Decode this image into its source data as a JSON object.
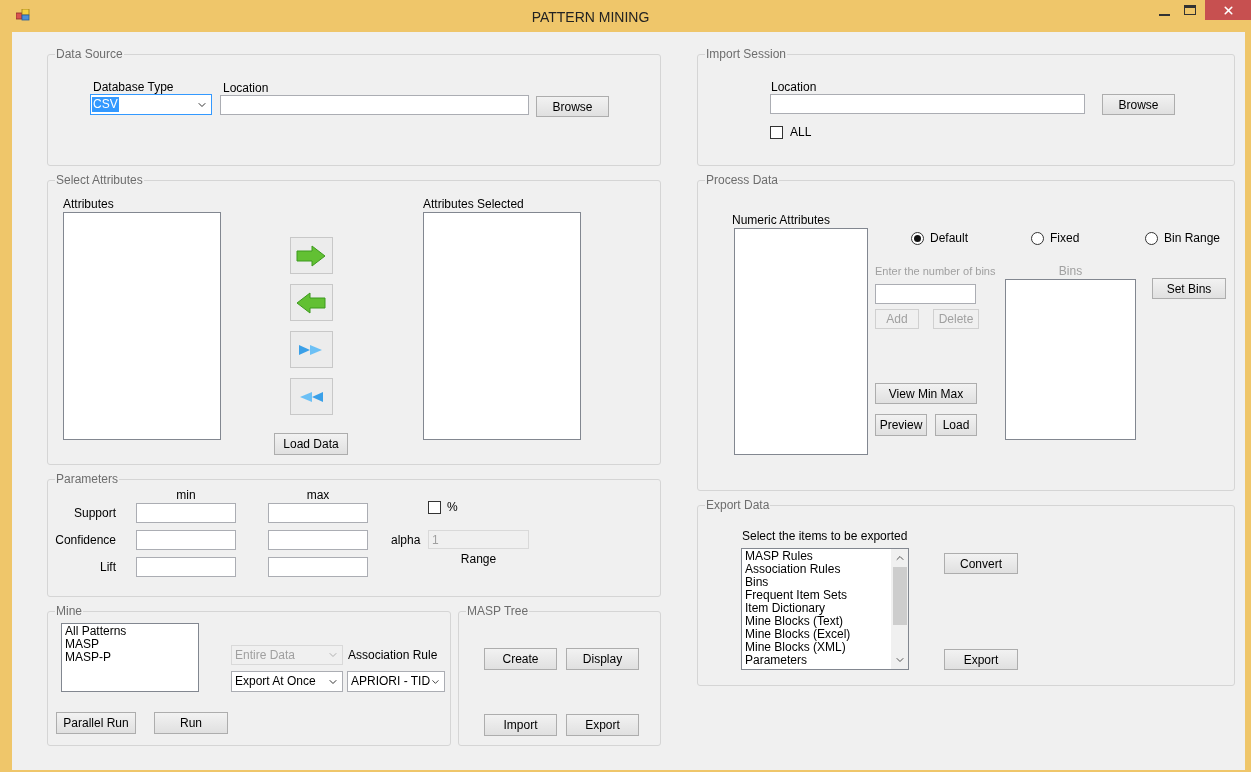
{
  "window": {
    "title": "PATTERN MINING"
  },
  "data_source": {
    "title": "Data Source",
    "database_type": {
      "label": "Database Type",
      "value": "CSV",
      "focused": true
    },
    "location_label": "Location",
    "browse": "Browse"
  },
  "select_attributes": {
    "title": "Select Attributes",
    "attributes_label": "Attributes",
    "selected_label": "Attributes Selected",
    "arrows": [
      {
        "kind": "right"
      },
      {
        "kind": "left"
      },
      {
        "kind": "all_right"
      },
      {
        "kind": "all_left"
      }
    ],
    "load_data": "Load Data"
  },
  "parameters": {
    "title": "Parameters",
    "min_label": "min",
    "max_label": "max",
    "rows": [
      {
        "label": "Support"
      },
      {
        "label": "Confidence"
      },
      {
        "label": "Lift"
      }
    ],
    "percent": {
      "label": "%",
      "checked": false
    },
    "alpha": {
      "label": "alpha",
      "value": "1",
      "disabled": true
    },
    "range_label": "Range"
  },
  "mine": {
    "title": "Mine",
    "patterns": [
      "All Patterns",
      "MASP",
      "MASP-P"
    ],
    "data_scope": {
      "value": "Entire Data",
      "disabled": true
    },
    "association_rule_label": "Association Rule",
    "export_mode": {
      "value": "Export At Once"
    },
    "algorithm": {
      "value": "APRIORI - TID"
    },
    "buttons": [
      "Parallel Run",
      "Run"
    ]
  },
  "masp_tree": {
    "title": "MASP Tree",
    "buttons": [
      "Create",
      "Display",
      "Import",
      "Export"
    ]
  },
  "import_session": {
    "title": "Import Session",
    "location_label": "Location",
    "browse": "Browse",
    "all": {
      "label": "ALL",
      "checked": false
    }
  },
  "process_data": {
    "title": "Process Data",
    "numeric_label": "Numeric Attributes",
    "modes": [
      {
        "label": "Default",
        "selected": true
      },
      {
        "label": "Fixed",
        "selected": false
      },
      {
        "label": "Bin Range",
        "selected": false
      }
    ],
    "bin_entry": {
      "label": "Enter the number of bins",
      "add": "Add",
      "delete": "Delete",
      "disabled": true
    },
    "bins": {
      "label": "Bins",
      "disabled": true
    },
    "set_bins": "Set Bins",
    "view_min_max": "View Min Max",
    "preview": "Preview",
    "load": "Load"
  },
  "export_data": {
    "title": "Export Data",
    "prompt": "Select the items to be exported",
    "items": [
      "MASP Rules",
      "Association Rules",
      "Bins",
      "Frequent Item Sets",
      "Item Dictionary",
      "Mine Blocks (Text)",
      "Mine Blocks (Excel)",
      "Mine Blocks (XML)",
      "Parameters"
    ],
    "convert": "Convert",
    "export": "Export"
  }
}
